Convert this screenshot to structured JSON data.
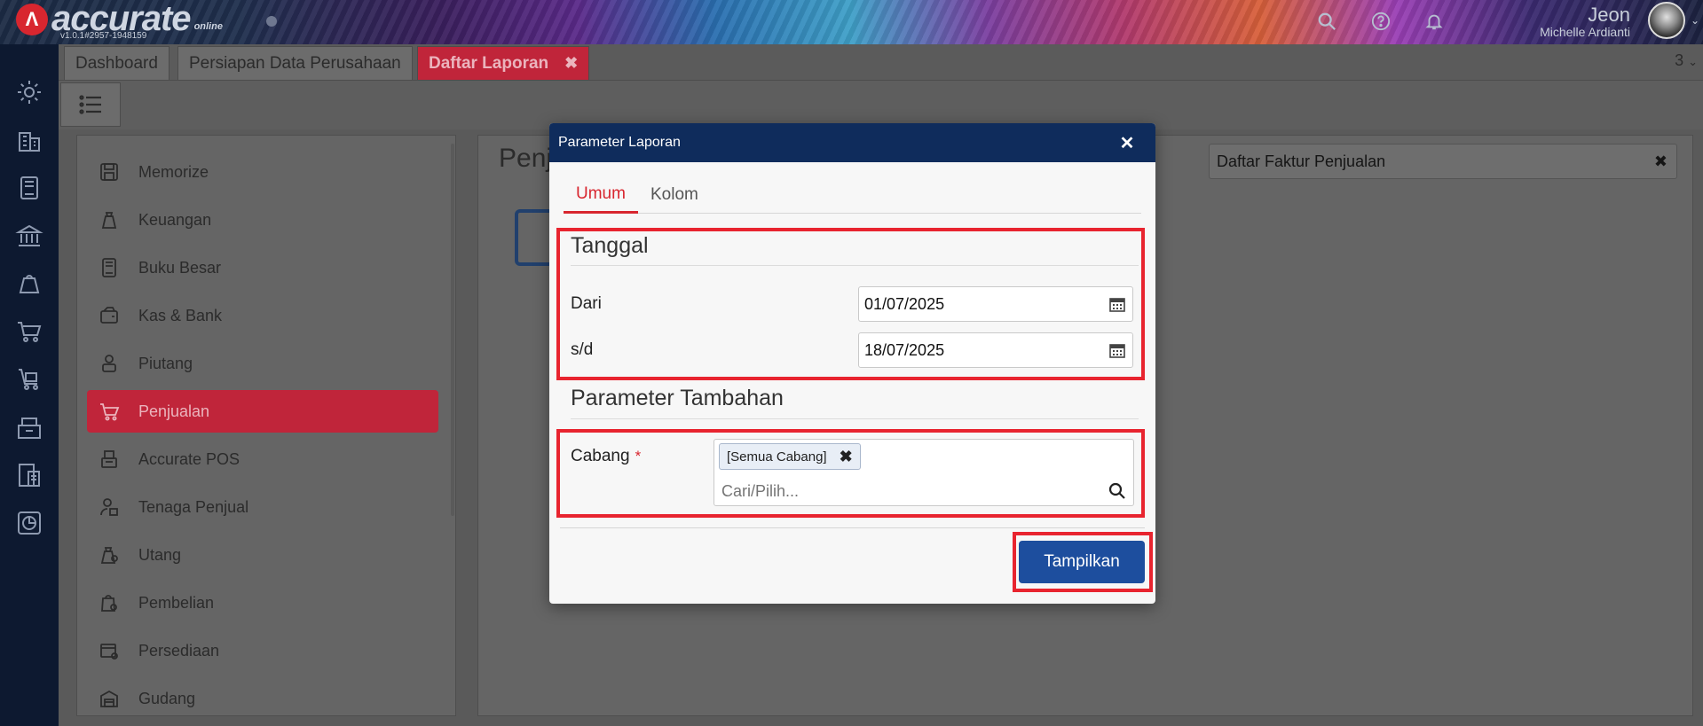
{
  "header": {
    "logo_text": "accurate",
    "logo_sub": "online",
    "version": "v1.0.1#2957-1948159",
    "user_name": "Jeon",
    "user_sub": "Michelle Ardianti"
  },
  "tabs": [
    {
      "label": "Dashboard"
    },
    {
      "label": "Persiapan Data Perusahaan"
    },
    {
      "label": "Daftar Laporan"
    }
  ],
  "tab_count": "3",
  "menu": {
    "items": [
      {
        "label": "Memorize"
      },
      {
        "label": "Keuangan"
      },
      {
        "label": "Buku Besar"
      },
      {
        "label": "Kas & Bank"
      },
      {
        "label": "Piutang"
      },
      {
        "label": "Penjualan"
      },
      {
        "label": "Accurate POS"
      },
      {
        "label": "Tenaga Penjual"
      },
      {
        "label": "Utang"
      },
      {
        "label": "Pembelian"
      },
      {
        "label": "Persediaan"
      },
      {
        "label": "Gudang"
      }
    ],
    "active_index": 5
  },
  "content": {
    "title": "Penj",
    "search_value": "Daftar Faktur Penjualan"
  },
  "modal": {
    "title": "Parameter Laporan",
    "tabs": [
      {
        "label": "Umum"
      },
      {
        "label": "Kolom"
      }
    ],
    "section_tanggal": "Tanggal",
    "dari_label": "Dari",
    "dari_value": "01/07/2025",
    "sd_label": "s/d",
    "sd_value": "18/07/2025",
    "section_tambahan": "Parameter Tambahan",
    "cabang_label": "Cabang",
    "cabang_required": "*",
    "cabang_chip": "[Semua Cabang]",
    "cabang_placeholder": "Cari/Pilih...",
    "submit_label": "Tampilkan"
  },
  "colors": {
    "accent_red": "#d8262f",
    "primary_blue": "#1d4e9e",
    "modal_header": "#0f2c5c",
    "highlight": "#e8242f"
  }
}
